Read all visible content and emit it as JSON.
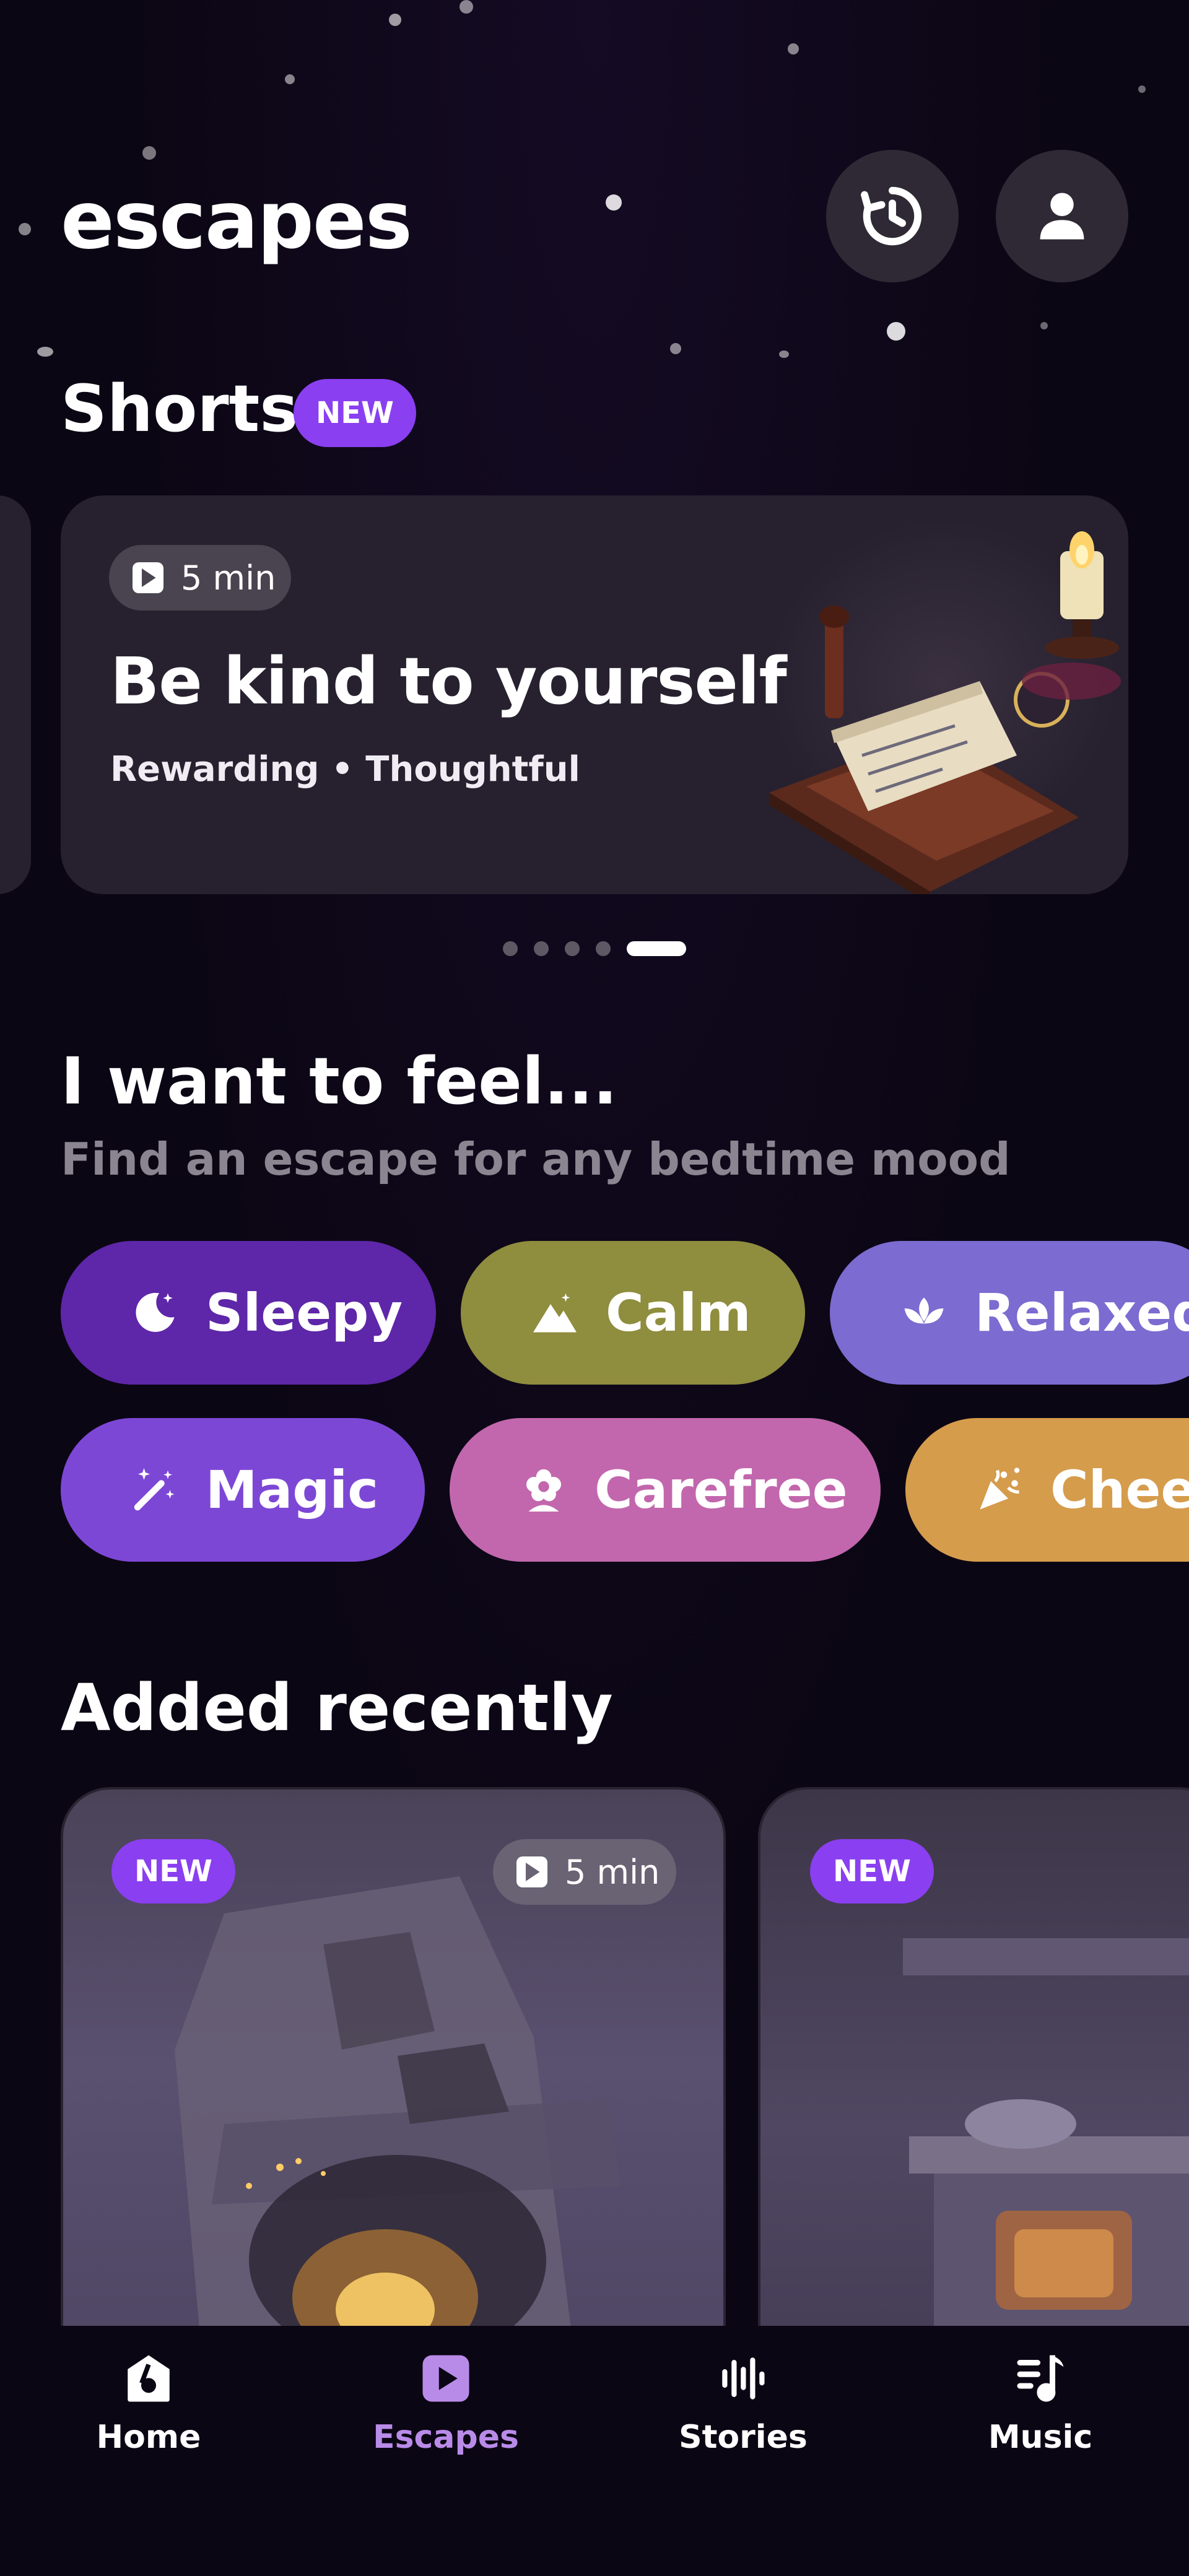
{
  "header": {
    "title": "escapes",
    "history_icon": "history-icon",
    "profile_icon": "user-icon"
  },
  "shorts": {
    "title": "Shorts",
    "badge": "NEW",
    "card": {
      "duration": "5 min",
      "title": "Be kind to yourself",
      "tags": "Rewarding • Thoughtful"
    },
    "pagination": {
      "count": 5,
      "active_index": 4
    }
  },
  "feel": {
    "title": "I want to feel...",
    "subtitle": "Find an escape for any bedtime mood",
    "moods": [
      {
        "label": "Sleepy",
        "icon": "moon-icon",
        "color": "#5e26a8"
      },
      {
        "label": "Calm",
        "icon": "mountain-icon",
        "color": "#8f8d3e"
      },
      {
        "label": "Relaxed",
        "icon": "lotus-icon",
        "color": "#7c6bd0"
      },
      {
        "label": "Magic",
        "icon": "magic-wand-icon",
        "color": "#7d47d6"
      },
      {
        "label": "Carefree",
        "icon": "flower-icon",
        "color": "#c267ad"
      },
      {
        "label": "Cheer",
        "icon": "party-popper-icon",
        "color": "#d59c4c"
      }
    ]
  },
  "recent": {
    "title": "Added recently",
    "cards": [
      {
        "badge": "NEW",
        "duration": "5 min"
      },
      {
        "badge": "NEW"
      }
    ]
  },
  "nav": {
    "items": [
      {
        "label": "Home",
        "icon": "home-icon",
        "active": false
      },
      {
        "label": "Escapes",
        "icon": "play-icon",
        "active": true
      },
      {
        "label": "Stories",
        "icon": "sound-wave-icon",
        "active": false
      },
      {
        "label": "Music",
        "icon": "music-note-icon",
        "active": false
      }
    ],
    "active_color": "#b98be8"
  }
}
